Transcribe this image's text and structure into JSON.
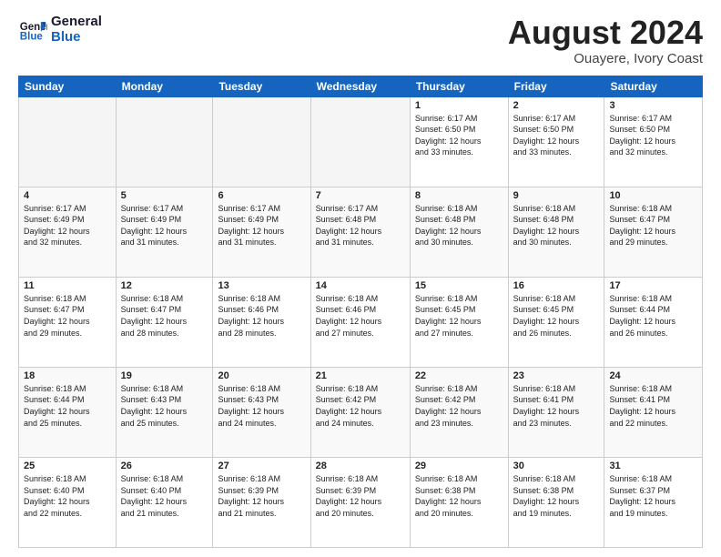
{
  "header": {
    "logo_line1": "General",
    "logo_line2": "Blue",
    "month": "August 2024",
    "location": "Ouayere, Ivory Coast"
  },
  "days_of_week": [
    "Sunday",
    "Monday",
    "Tuesday",
    "Wednesday",
    "Thursday",
    "Friday",
    "Saturday"
  ],
  "weeks": [
    [
      {
        "day": "",
        "info": ""
      },
      {
        "day": "",
        "info": ""
      },
      {
        "day": "",
        "info": ""
      },
      {
        "day": "",
        "info": ""
      },
      {
        "day": "1",
        "info": "Sunrise: 6:17 AM\nSunset: 6:50 PM\nDaylight: 12 hours\nand 33 minutes."
      },
      {
        "day": "2",
        "info": "Sunrise: 6:17 AM\nSunset: 6:50 PM\nDaylight: 12 hours\nand 33 minutes."
      },
      {
        "day": "3",
        "info": "Sunrise: 6:17 AM\nSunset: 6:50 PM\nDaylight: 12 hours\nand 32 minutes."
      }
    ],
    [
      {
        "day": "4",
        "info": "Sunrise: 6:17 AM\nSunset: 6:49 PM\nDaylight: 12 hours\nand 32 minutes."
      },
      {
        "day": "5",
        "info": "Sunrise: 6:17 AM\nSunset: 6:49 PM\nDaylight: 12 hours\nand 31 minutes."
      },
      {
        "day": "6",
        "info": "Sunrise: 6:17 AM\nSunset: 6:49 PM\nDaylight: 12 hours\nand 31 minutes."
      },
      {
        "day": "7",
        "info": "Sunrise: 6:17 AM\nSunset: 6:48 PM\nDaylight: 12 hours\nand 31 minutes."
      },
      {
        "day": "8",
        "info": "Sunrise: 6:18 AM\nSunset: 6:48 PM\nDaylight: 12 hours\nand 30 minutes."
      },
      {
        "day": "9",
        "info": "Sunrise: 6:18 AM\nSunset: 6:48 PM\nDaylight: 12 hours\nand 30 minutes."
      },
      {
        "day": "10",
        "info": "Sunrise: 6:18 AM\nSunset: 6:47 PM\nDaylight: 12 hours\nand 29 minutes."
      }
    ],
    [
      {
        "day": "11",
        "info": "Sunrise: 6:18 AM\nSunset: 6:47 PM\nDaylight: 12 hours\nand 29 minutes."
      },
      {
        "day": "12",
        "info": "Sunrise: 6:18 AM\nSunset: 6:47 PM\nDaylight: 12 hours\nand 28 minutes."
      },
      {
        "day": "13",
        "info": "Sunrise: 6:18 AM\nSunset: 6:46 PM\nDaylight: 12 hours\nand 28 minutes."
      },
      {
        "day": "14",
        "info": "Sunrise: 6:18 AM\nSunset: 6:46 PM\nDaylight: 12 hours\nand 27 minutes."
      },
      {
        "day": "15",
        "info": "Sunrise: 6:18 AM\nSunset: 6:45 PM\nDaylight: 12 hours\nand 27 minutes."
      },
      {
        "day": "16",
        "info": "Sunrise: 6:18 AM\nSunset: 6:45 PM\nDaylight: 12 hours\nand 26 minutes."
      },
      {
        "day": "17",
        "info": "Sunrise: 6:18 AM\nSunset: 6:44 PM\nDaylight: 12 hours\nand 26 minutes."
      }
    ],
    [
      {
        "day": "18",
        "info": "Sunrise: 6:18 AM\nSunset: 6:44 PM\nDaylight: 12 hours\nand 25 minutes."
      },
      {
        "day": "19",
        "info": "Sunrise: 6:18 AM\nSunset: 6:43 PM\nDaylight: 12 hours\nand 25 minutes."
      },
      {
        "day": "20",
        "info": "Sunrise: 6:18 AM\nSunset: 6:43 PM\nDaylight: 12 hours\nand 24 minutes."
      },
      {
        "day": "21",
        "info": "Sunrise: 6:18 AM\nSunset: 6:42 PM\nDaylight: 12 hours\nand 24 minutes."
      },
      {
        "day": "22",
        "info": "Sunrise: 6:18 AM\nSunset: 6:42 PM\nDaylight: 12 hours\nand 23 minutes."
      },
      {
        "day": "23",
        "info": "Sunrise: 6:18 AM\nSunset: 6:41 PM\nDaylight: 12 hours\nand 23 minutes."
      },
      {
        "day": "24",
        "info": "Sunrise: 6:18 AM\nSunset: 6:41 PM\nDaylight: 12 hours\nand 22 minutes."
      }
    ],
    [
      {
        "day": "25",
        "info": "Sunrise: 6:18 AM\nSunset: 6:40 PM\nDaylight: 12 hours\nand 22 minutes."
      },
      {
        "day": "26",
        "info": "Sunrise: 6:18 AM\nSunset: 6:40 PM\nDaylight: 12 hours\nand 21 minutes."
      },
      {
        "day": "27",
        "info": "Sunrise: 6:18 AM\nSunset: 6:39 PM\nDaylight: 12 hours\nand 21 minutes."
      },
      {
        "day": "28",
        "info": "Sunrise: 6:18 AM\nSunset: 6:39 PM\nDaylight: 12 hours\nand 20 minutes."
      },
      {
        "day": "29",
        "info": "Sunrise: 6:18 AM\nSunset: 6:38 PM\nDaylight: 12 hours\nand 20 minutes."
      },
      {
        "day": "30",
        "info": "Sunrise: 6:18 AM\nSunset: 6:38 PM\nDaylight: 12 hours\nand 19 minutes."
      },
      {
        "day": "31",
        "info": "Sunrise: 6:18 AM\nSunset: 6:37 PM\nDaylight: 12 hours\nand 19 minutes."
      }
    ]
  ]
}
